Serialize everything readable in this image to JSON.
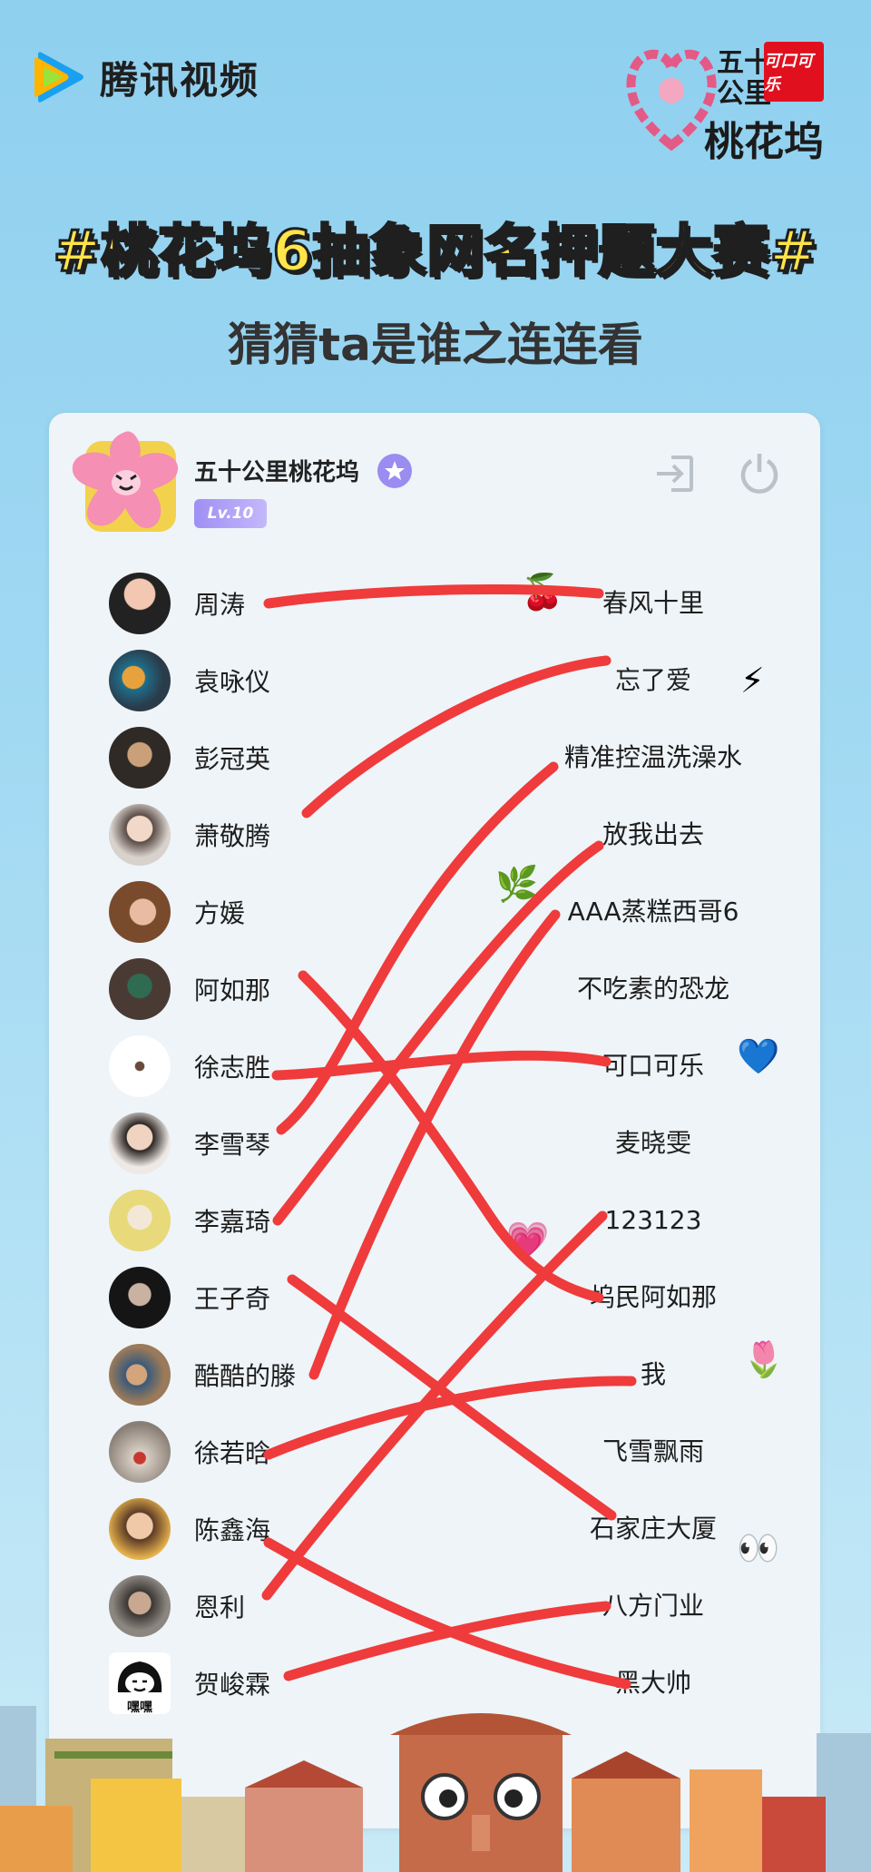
{
  "brand": {
    "name": "腾讯视频"
  },
  "partner_logo": {
    "line1": "五十",
    "line2": "公里",
    "line3": "桃花坞",
    "sponsor": "可口可乐"
  },
  "headline": "#桃花坞6抽象网名押题大赛#",
  "subline": "猜猜ta是谁之连连看",
  "profile": {
    "name": "五十公里桃花坞",
    "level": "Lv.10"
  },
  "left_names": [
    "周涛",
    "袁咏仪",
    "彭冠英",
    "萧敬腾",
    "方媛",
    "阿如那",
    "徐志胜",
    "李雪琴",
    "李嘉琦",
    "王子奇",
    "酷酷的滕",
    "徐若晗",
    "陈鑫海",
    "恩利",
    "贺峻霖"
  ],
  "avatar_caption": "嘿嘿",
  "right_names": [
    "春风十里",
    "忘了爱",
    "精准控温洗澡水",
    "放我出去",
    "AAA蒸糕西哥6",
    "不吃素的恐龙",
    "可口可乐",
    "麦晓雯",
    "123123",
    "坞民阿如那",
    "我",
    "飞雪飘雨",
    "石家庄大厦",
    "八方门业",
    "黑大帅"
  ],
  "emojis": {
    "e1": "🍒",
    "e2": "⚡",
    "e3": "🌿",
    "e4": "💙",
    "e5": "💗",
    "e6": "🌷",
    "e7": "👀"
  },
  "colors": {
    "scribble": "#ef3b3b",
    "accent": "#9a8cf0",
    "headline": "#ffe44a"
  }
}
